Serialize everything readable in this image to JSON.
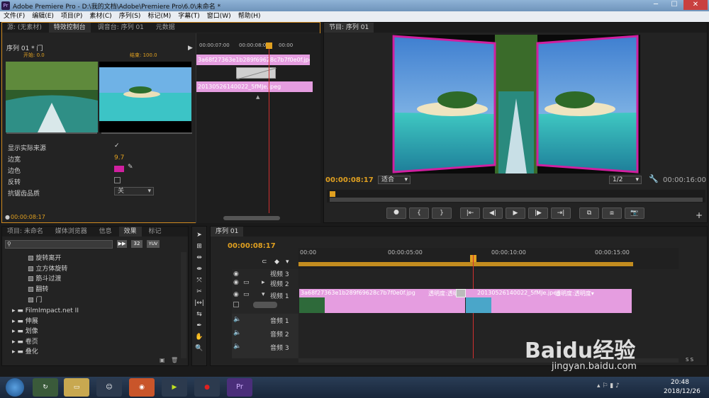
{
  "titlebar": {
    "app_icon": "Pr",
    "title": "Adobe Premiere Pro - D:\\我的文档\\Adobe\\Premiere Pro\\6.0\\未命名 *"
  },
  "menu": [
    "文件(F)",
    "编辑(E)",
    "项目(P)",
    "素材(C)",
    "序列(S)",
    "标记(M)",
    "字幕(T)",
    "窗口(W)",
    "帮助(H)"
  ],
  "source_panel": {
    "tabs": [
      "源: (无素材)",
      "特效控制台",
      "调音台: 序列 01",
      "元数据"
    ],
    "sequence_label": "序列 01 * 门",
    "start_label": "开始: 0.0",
    "end_label": "结束: 100.0",
    "ruler_times": [
      "00:00:07:00",
      "00:00:08:00",
      "00:00"
    ],
    "clip_a": "3a68f27363e1b289f69628c7b7f0e0f.jpg",
    "clip_b": "20130526140022_5fMJe.jpeg",
    "props": [
      {
        "label": "显示实际来源",
        "value": "✓"
      },
      {
        "label": "边宽",
        "value": "9.7"
      },
      {
        "label": "边色",
        "value": ""
      },
      {
        "label": "反转",
        "value": ""
      },
      {
        "label": "抗锯齿品质",
        "value": "关"
      }
    ],
    "current_time": "00:00:08:17"
  },
  "program_panel": {
    "tab": "节目: 序列 01",
    "current_time": "00:00:08:17",
    "fit_label": "适合",
    "quality_label": "1/2",
    "duration": "00:00:16:00",
    "transport": [
      "⯃",
      "{",
      "}",
      "|⇤",
      "◀|",
      "▶",
      "|▶",
      "⇥|",
      "⧉",
      "⧈",
      "📷"
    ]
  },
  "project_panel": {
    "tabs": [
      "项目: 未命名",
      "媒体浏览器",
      "信息",
      "效果",
      "标记"
    ],
    "search_placeholder": "",
    "badges": [
      "32",
      "YUV"
    ],
    "items": [
      "旋转离开",
      "立方体旋转",
      "筋斗过渡",
      "翻转",
      "门"
    ],
    "folders": [
      "FilmImpact.net II",
      "伸展",
      "划像",
      "卷页",
      "叠化"
    ]
  },
  "timeline": {
    "tab": "序列 01",
    "current_time": "00:00:08:17",
    "ruler": [
      "00:00",
      "00:00:05:00",
      "00:00:10:00",
      "00:00:15:00"
    ],
    "video_tracks": [
      "视频 3",
      "视频 2",
      "视频 1"
    ],
    "audio_tracks": [
      "音频 1",
      "音频 2",
      "音频 3"
    ],
    "clip_a_label": "3a68f27363e1b289f69628c7b7f0e0f.jpg",
    "clip_a_opacity": "透明度:透明度▾",
    "clip_b_label": "20130526140022_5fMJe.jpeg",
    "clip_b_opacity": "透明度:透明度▾"
  },
  "taskbar": {
    "time": "20:48",
    "date": "2018/12/26"
  },
  "watermark": {
    "text": "Baidu经验",
    "url": "jingyan.baidu.com"
  },
  "colors": {
    "accent_orange": "#e0a020",
    "clip_pink": "#e59de0",
    "playhead_red": "#d03030",
    "edge_magenta": "#d020a0"
  }
}
